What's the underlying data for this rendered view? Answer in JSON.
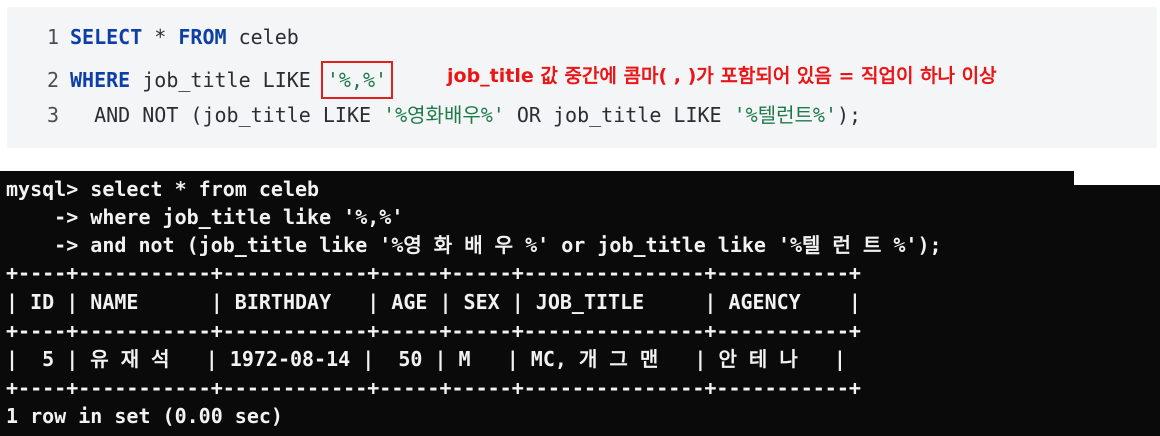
{
  "editor": {
    "lines": [
      {
        "num": "1",
        "kw1": "SELECT",
        "mid": " * ",
        "kw2": "FROM",
        "rest": " celeb"
      },
      {
        "num": "2",
        "kw": "WHERE",
        "text": " job_title LIKE ",
        "str": "'%,%'"
      },
      {
        "num": "3",
        "indent": "  ",
        "p1": "AND NOT (job_title LIKE ",
        "s1": "'%영화배우%'",
        "p2": " OR job_title LIKE ",
        "s2": "'%텔런트%'",
        "p3": ");"
      }
    ],
    "annotation": "job_title 값 중간에 콤마( , )가 포함되어 있음 = 직업이 하나 이상"
  },
  "terminal": {
    "lines": [
      "mysql> select * from celeb",
      "    -> where job_title like '%,%'",
      "    -> and not (job_title like '%영 화 배 우 %' or job_title like '%텔 런 트 %');",
      "+----+-----------+------------+-----+-----+---------------+-----------+",
      "| ID | NAME      | BIRTHDAY   | AGE | SEX | JOB_TITLE     | AGENCY    |",
      "+----+-----------+------------+-----+-----+---------------+-----------+",
      "|  5 | 유 재 석   | 1972-08-14 |  50 | M   | MC, 개 그 맨   | 안 테 나   |",
      "+----+-----------+------------+-----+-----+---------------+-----------+",
      "1 row in set (0.00 sec)"
    ]
  }
}
